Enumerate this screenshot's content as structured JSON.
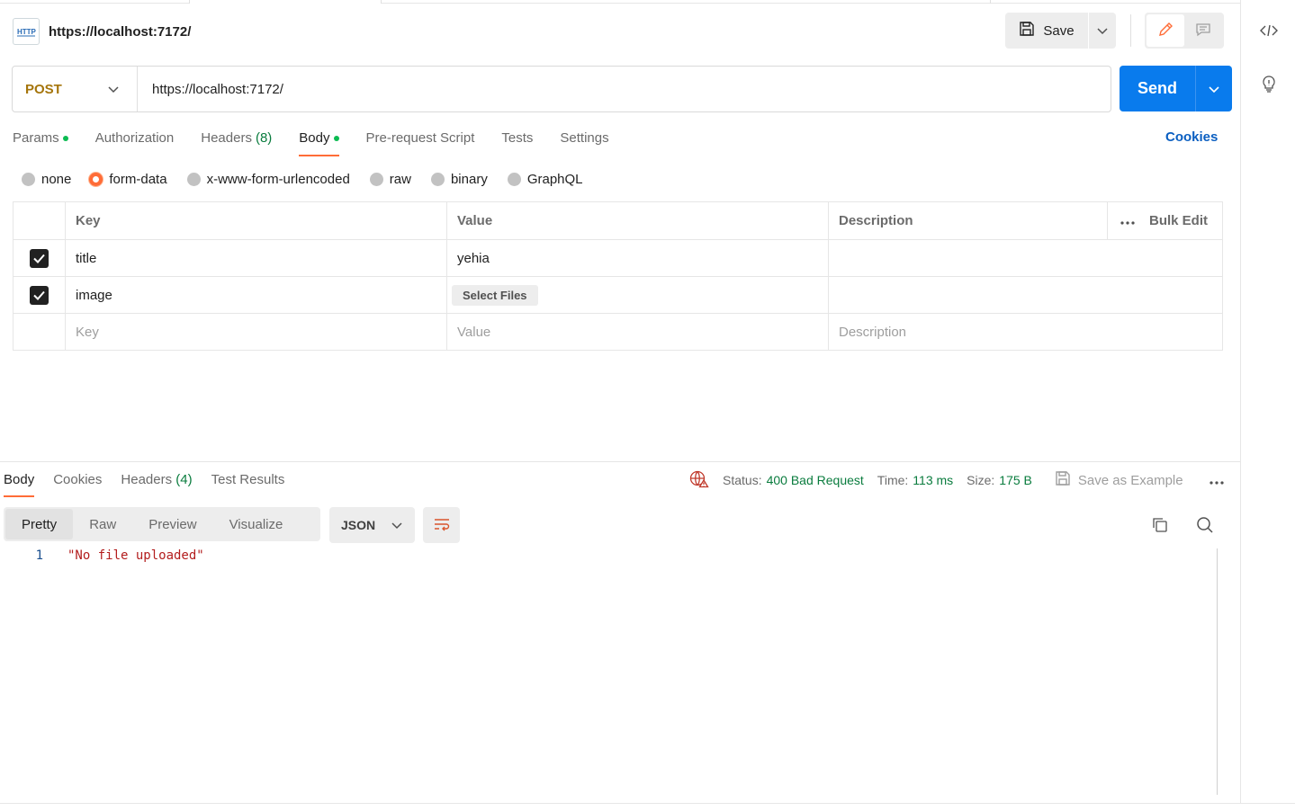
{
  "request": {
    "title": "https://localhost:7172/",
    "method": "POST",
    "url": "https://localhost:7172/"
  },
  "toolbar": {
    "save_label": "Save",
    "send_label": "Send"
  },
  "request_tabs": [
    {
      "label": "Params",
      "count": "",
      "dot": true,
      "active": false
    },
    {
      "label": "Authorization",
      "count": "",
      "dot": false,
      "active": false
    },
    {
      "label": "Headers",
      "count": "(8)",
      "dot": false,
      "active": false
    },
    {
      "label": "Body",
      "count": "",
      "dot": true,
      "active": true
    },
    {
      "label": "Pre-request Script",
      "count": "",
      "dot": false,
      "active": false
    },
    {
      "label": "Tests",
      "count": "",
      "dot": false,
      "active": false
    },
    {
      "label": "Settings",
      "count": "",
      "dot": false,
      "active": false
    }
  ],
  "cookies_label": "Cookies",
  "body_types": [
    {
      "label": "none",
      "checked": false
    },
    {
      "label": "form-data",
      "checked": true
    },
    {
      "label": "x-www-form-urlencoded",
      "checked": false
    },
    {
      "label": "raw",
      "checked": false
    },
    {
      "label": "binary",
      "checked": false
    },
    {
      "label": "GraphQL",
      "checked": false
    }
  ],
  "table": {
    "headers": {
      "key": "Key",
      "value": "Value",
      "description": "Description",
      "bulk_edit": "Bulk Edit"
    },
    "rows": [
      {
        "checked": true,
        "key": "title",
        "value": "yehia",
        "description": ""
      },
      {
        "checked": true,
        "key": "image",
        "value_button": "Select Files",
        "description": ""
      }
    ],
    "placeholders": {
      "key": "Key",
      "value": "Value",
      "description": "Description"
    }
  },
  "response": {
    "tabs": [
      {
        "label": "Body",
        "count": "",
        "active": true
      },
      {
        "label": "Cookies",
        "count": "",
        "active": false
      },
      {
        "label": "Headers",
        "count": "(4)",
        "active": false
      },
      {
        "label": "Test Results",
        "count": "",
        "active": false
      }
    ],
    "status_label": "Status:",
    "status_value": "400 Bad Request",
    "time_label": "Time:",
    "time_value": "113 ms",
    "size_label": "Size:",
    "size_value": "175 B",
    "save_example_label": "Save as Example",
    "view_modes": [
      {
        "label": "Pretty",
        "active": true
      },
      {
        "label": "Raw",
        "active": false
      },
      {
        "label": "Preview",
        "active": false
      },
      {
        "label": "Visualize",
        "active": false
      }
    ],
    "format": "JSON",
    "lines": [
      {
        "no": "1",
        "text": "\"No file uploaded\""
      }
    ]
  },
  "colors": {
    "accent": "#ff6c37",
    "send": "#097bed",
    "method": "#a5750b",
    "success_green": "#0a7c3e",
    "string_red": "#b31d1d"
  },
  "icons": [
    "http-icon",
    "save-icon",
    "chevron-down-icon",
    "edit-icon",
    "comment-icon",
    "code-icon",
    "lightbulb-icon",
    "check-icon",
    "ellipsis-icon",
    "globe-error-icon",
    "wrap-icon",
    "copy-icon",
    "search-icon"
  ]
}
